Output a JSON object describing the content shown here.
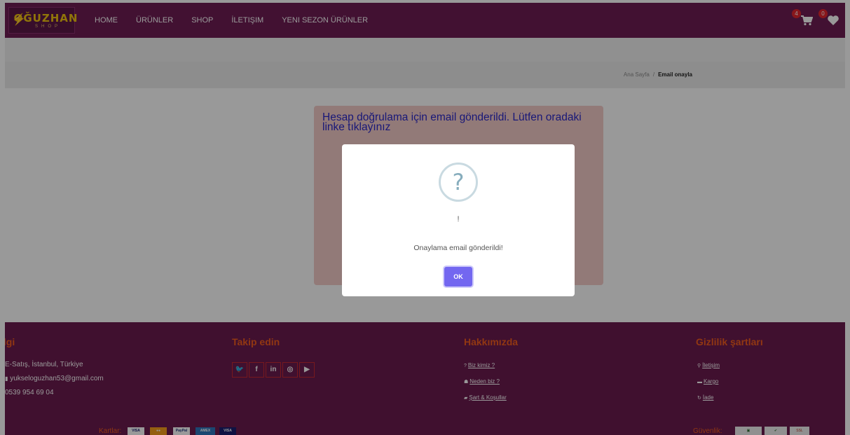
{
  "brand": {
    "logo_main": "OĞUZHAN",
    "logo_sub": "SHOP"
  },
  "nav": {
    "items": [
      "HOME",
      "ÜRÜNLER",
      "SHOP",
      "İLETIŞIM",
      "YENI SEZON ÜRÜNLER"
    ]
  },
  "cart": {
    "count": "4",
    "icon": "cart-icon"
  },
  "wishlist": {
    "count": "0",
    "icon": "heart-icon"
  },
  "breadcrumb": {
    "home": "Ana Sayfa",
    "separator": "/",
    "current": "Email onayla"
  },
  "alert": {
    "message": "Hesap doğrulama için email gönderildi. Lütfen oradaki linke tıklayınız"
  },
  "modal": {
    "icon": "question-icon",
    "icon_glyph": "?",
    "title": "!",
    "text": "Onaylama email gönderildi!",
    "ok_label": "OK"
  },
  "footer": {
    "info": {
      "title": "ilgi",
      "address": "E-Satış, İstanbul, Türkiye",
      "email": "yukseloguzhan53@gmail.com",
      "phone": "0539 954 69 04"
    },
    "follow": {
      "title": "Takip edin",
      "networks": [
        "twitter",
        "facebook",
        "linkedin",
        "instagram",
        "youtube"
      ]
    },
    "about": {
      "title": "Hakkımızda",
      "links": [
        "Biz kimiz ?",
        "Neden biz ?",
        "Şart & Koşullar"
      ]
    },
    "privacy": {
      "title": "Gizlilik şartları",
      "links": [
        "İletişim",
        "Kargo",
        "İade"
      ]
    },
    "cards_label": "Kartlar:",
    "security_label": "Güvenlik:"
  },
  "colors": {
    "navbar": "#6e1d54",
    "footer": "#6b1b4f",
    "footer_heading": "#f25c1e",
    "badge": "#e3262e",
    "ok_button": "#7367f0",
    "alert_bg": "#f4ccc9",
    "alert_text": "#2b28c9"
  }
}
